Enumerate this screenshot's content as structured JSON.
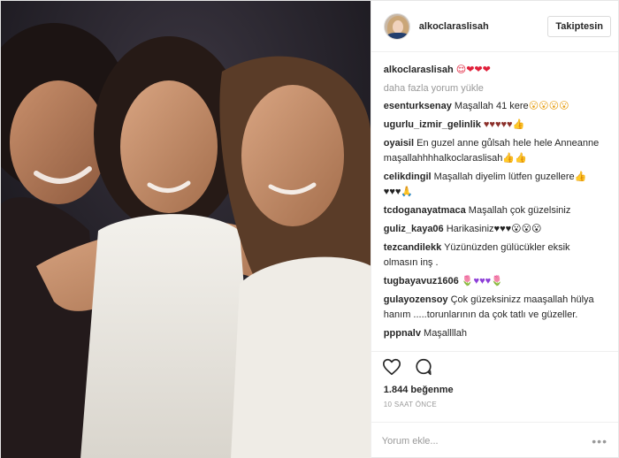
{
  "header": {
    "username": "alkoclaraslisah",
    "follow_label": "Takiptesin"
  },
  "caption": {
    "username": "alkoclaraslisah",
    "text": "",
    "emoji": "😌❤❤❤"
  },
  "load_more": "daha fazla yorum yükle",
  "comments": [
    {
      "user": "esenturksenay",
      "text": "Maşallah 41 kere",
      "emoji": "😮😮😮😮",
      "emoji_color": "yellow"
    },
    {
      "user": "ugurlu_izmir_gelinlik",
      "text": "",
      "emoji": "♥♥♥♥♥👍",
      "emoji_color": "brown"
    },
    {
      "user": "oyaisil",
      "text": "En guzel anne gůlsah hele hele Anneanne maşallahhhhalkoclaraslisah",
      "emoji": "👍👍",
      "emoji_color": "grey"
    },
    {
      "user": "celikdingil",
      "text": "Maşallah diyelim lütfen guzellere",
      "emoji": "👍 ♥♥♥🙏",
      "emoji_color": "black"
    },
    {
      "user": "tcdoganayatmaca",
      "text": "Maşallah çok güzelsiniz",
      "emoji": "",
      "emoji_color": ""
    },
    {
      "user": "guliz_kaya06",
      "text": "Harikasiniz",
      "emoji": "♥♥♥😮😮😮",
      "emoji_color": "black"
    },
    {
      "user": "tezcandilekk",
      "text": "Yüzünüzden gülücükler eksik olmasın inş .",
      "emoji": "",
      "emoji_color": ""
    },
    {
      "user": "tugbayavuz1606",
      "text": "",
      "emoji": "🌷♥♥♥🌷",
      "emoji_color": "purple"
    },
    {
      "user": "gulayozensoy",
      "text": "Çok güzeksinizz maaşallah hülya hanım .....torunlarının da çok tatlı ve güzeller.",
      "emoji": "",
      "emoji_color": ""
    },
    {
      "user": "pppnalv",
      "text": "Maşallllah",
      "emoji": "",
      "emoji_color": ""
    }
  ],
  "likes": "1.844 beğenme",
  "timestamp": "10 SAAT ÖNCE",
  "comment_input": {
    "placeholder": "Yorum ekle..."
  },
  "icons": {
    "like": "heart-icon",
    "comment": "comment-bubble-icon",
    "options": "more-options-icon"
  },
  "colors": {
    "text": "#262626",
    "muted": "#999999",
    "border": "#efefef",
    "photo_bg": "#1b1a1e"
  }
}
